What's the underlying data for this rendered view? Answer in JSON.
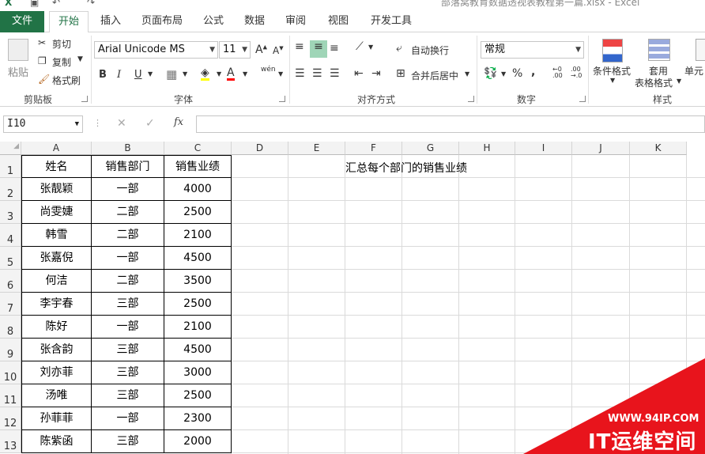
{
  "window": {
    "title": "部落窝教育数据透视表教程第一篇.xlsx - Excel"
  },
  "tabs": [
    "文件",
    "开始",
    "插入",
    "页面布局",
    "公式",
    "数据",
    "审阅",
    "视图",
    "开发工具"
  ],
  "clipboard": {
    "paste": "粘贴",
    "cut": "剪切",
    "copy": "复制",
    "format_painter": "格式刷",
    "group": "剪贴板"
  },
  "font": {
    "name": "Arial Unicode MS",
    "size": "11",
    "group": "字体",
    "phonetic": "wén"
  },
  "alignment": {
    "wrap": "自动换行",
    "merge": "合并后居中",
    "group": "对齐方式"
  },
  "number": {
    "format": "常规",
    "group": "数字"
  },
  "styles": {
    "conditional": "条件格式",
    "table_format_1": "套用",
    "table_format_2": "表格格式",
    "cell_styles": "单元",
    "group": "样式"
  },
  "formula_bar": {
    "name_box": "I10",
    "fx": "fx",
    "formula": ""
  },
  "columns": [
    "A",
    "B",
    "C",
    "D",
    "E",
    "F",
    "G",
    "H",
    "I",
    "J",
    "K"
  ],
  "rows": [
    "1",
    "2",
    "3",
    "4",
    "5",
    "6",
    "7",
    "8",
    "9",
    "10",
    "11",
    "12",
    "13"
  ],
  "table": {
    "headers": [
      "姓名",
      "销售部门",
      "销售业绩"
    ],
    "rows": [
      [
        "张靓颖",
        "一部",
        "4000"
      ],
      [
        "尚雯婕",
        "二部",
        "2500"
      ],
      [
        "韩雪",
        "二部",
        "2100"
      ],
      [
        "张嘉倪",
        "一部",
        "4500"
      ],
      [
        "何洁",
        "二部",
        "3500"
      ],
      [
        "李宇春",
        "三部",
        "2500"
      ],
      [
        "陈好",
        "一部",
        "2100"
      ],
      [
        "张含韵",
        "三部",
        "4500"
      ],
      [
        "刘亦菲",
        "三部",
        "3000"
      ],
      [
        "汤唯",
        "三部",
        "2500"
      ],
      [
        "孙菲菲",
        "一部",
        "2300"
      ],
      [
        "陈紫函",
        "三部",
        "2000"
      ]
    ]
  },
  "note": "汇总每个部门的销售业绩",
  "watermark": {
    "url": "WWW.94IP.COM",
    "text": "IT运维空间"
  },
  "colors": {
    "accent": "#217346",
    "watermark": "#e8141c"
  }
}
